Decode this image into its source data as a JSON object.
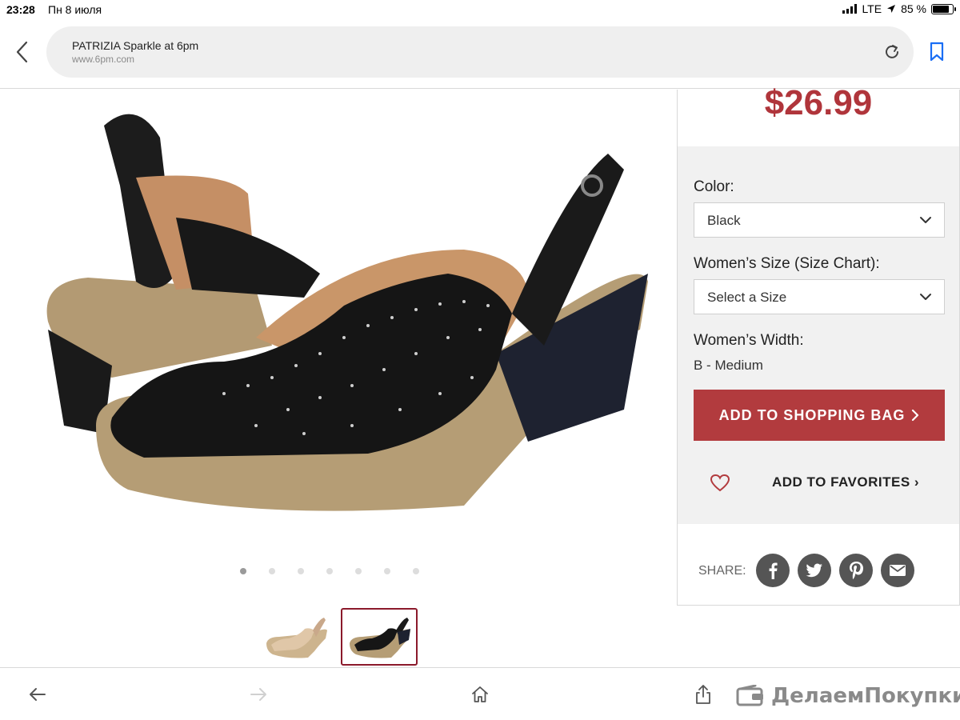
{
  "status_bar": {
    "time": "23:28",
    "date": "Пн 8 июля",
    "network": "LTE",
    "battery": "85 %",
    "battery_level": 0.85
  },
  "browser": {
    "tab_title": "PATRIZIA Sparkle at 6pm",
    "domain": "www.6pm.com"
  },
  "product": {
    "price": "$26.99",
    "carousel_pages": 7,
    "carousel_active": 0,
    "thumbnails": [
      {
        "name": "beige",
        "selected": false
      },
      {
        "name": "black",
        "selected": true
      }
    ]
  },
  "options": {
    "color_label": "Color:",
    "color_value": "Black",
    "size_label": "Women’s Size (Size Chart):",
    "size_placeholder": "Select a Size",
    "width_label": "Women’s Width:",
    "width_value": "B - Medium",
    "add_to_bag": "ADD TO SHOPPING BAG",
    "add_to_favorites": "ADD TO FAVORITES"
  },
  "share": {
    "label": "SHARE:",
    "icons": [
      "facebook-icon",
      "twitter-icon",
      "pinterest-icon",
      "email-icon"
    ]
  },
  "watermark": "ДелаемПокупки.Ру",
  "colors": {
    "accent": "#b23b3e",
    "price": "#b0353b",
    "panel_bg": "#f1f1f1",
    "safari_blue": "#1a6ef5"
  }
}
